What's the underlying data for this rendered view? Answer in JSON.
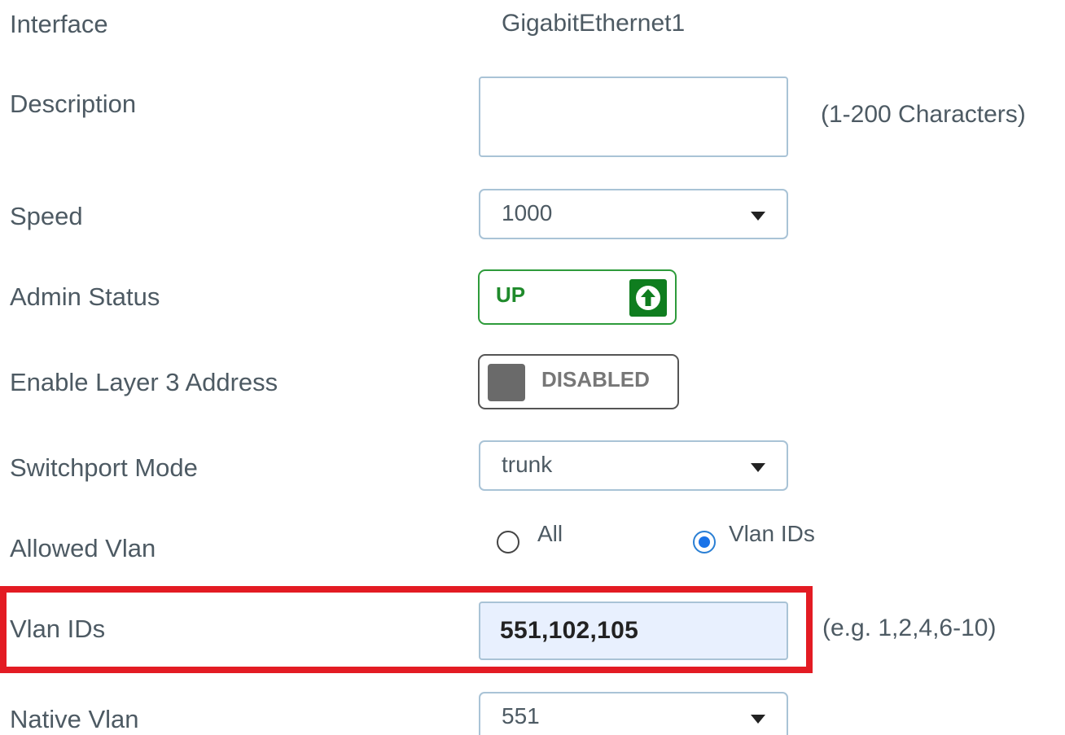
{
  "form": {
    "interface": {
      "label": "Interface",
      "value": "GigabitEthernet1"
    },
    "description": {
      "label": "Description",
      "value": "",
      "hint": "(1-200 Characters)"
    },
    "speed": {
      "label": "Speed",
      "value": "1000"
    },
    "admin_status": {
      "label": "Admin Status",
      "state": "UP",
      "icon": "arrow-up-icon",
      "color": "#0f7d1f"
    },
    "layer3": {
      "label": "Enable Layer 3 Address",
      "state": "DISABLED"
    },
    "switchport_mode": {
      "label": "Switchport Mode",
      "value": "trunk"
    },
    "allowed_vlan": {
      "label": "Allowed Vlan",
      "options": [
        {
          "label": "All",
          "selected": false
        },
        {
          "label": "Vlan IDs",
          "selected": true
        }
      ]
    },
    "vlan_ids": {
      "label": "Vlan IDs",
      "value": "551,102,105",
      "hint": "(e.g. 1,2,4,6-10)",
      "highlight_color": "#e31b23"
    },
    "native_vlan": {
      "label": "Native Vlan",
      "value": "551"
    }
  }
}
